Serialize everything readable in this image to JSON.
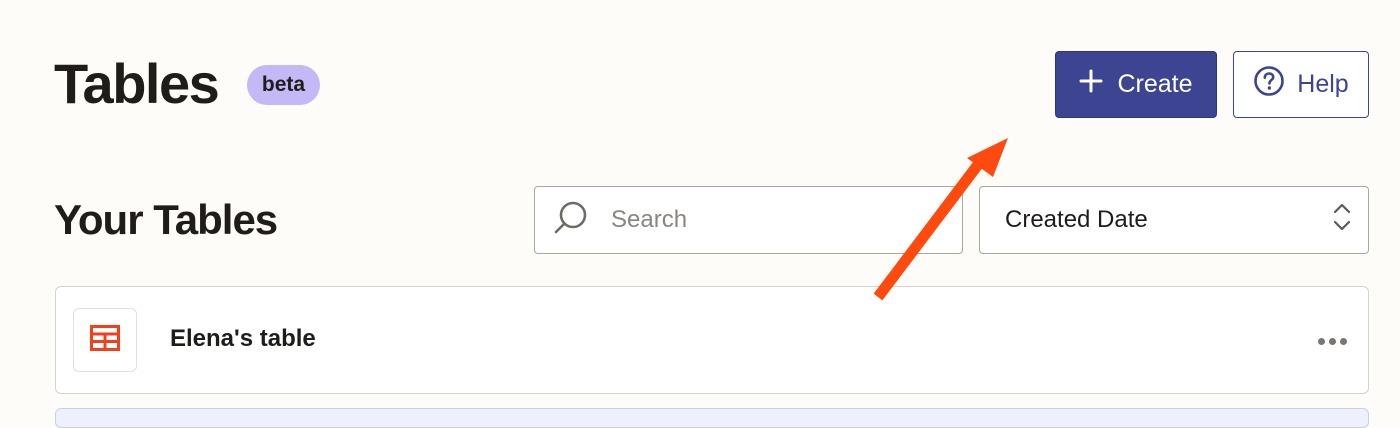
{
  "header": {
    "title": "Tables",
    "badge": "beta",
    "create_label": "Create",
    "help_label": "Help"
  },
  "section": {
    "title": "Your Tables"
  },
  "search": {
    "placeholder": "Search",
    "value": ""
  },
  "sort": {
    "selected": "Created Date"
  },
  "tables": [
    {
      "name": "Elena's table",
      "icon": "table-grid-icon"
    }
  ],
  "colors": {
    "primary": "#3d4592",
    "badge": "#c5b8f7",
    "table_icon": "#f0401c",
    "annotation_arrow": "#ff4a0f"
  },
  "annotation": {
    "type": "arrow",
    "points_to": "create-button"
  }
}
